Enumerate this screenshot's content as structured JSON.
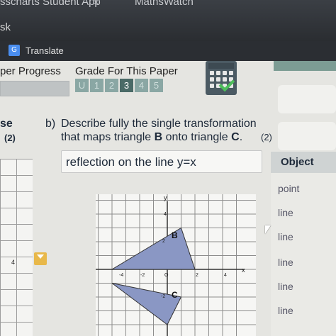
{
  "browser": {
    "tab_title": "sscharts Student App",
    "tab_close": "×",
    "tab_second": "MathsWatch",
    "address_prefix": "sk",
    "bookmark_translate": "Translate"
  },
  "header": {
    "paper_progress_label": "per Progress",
    "grade_label": "Grade For This Paper",
    "grades": [
      "U",
      "1",
      "2",
      "3",
      "4",
      "5"
    ],
    "active_grade": "3"
  },
  "left_panel": {
    "label": "se",
    "marks": "(2)",
    "axis_label": "4"
  },
  "question": {
    "part": "b)",
    "line1": "Describe fully the single transformation",
    "line2_prefix": "that maps triangle ",
    "line2_b": "B",
    "line2_mid": " onto triangle ",
    "line2_c": "C",
    "line2_end": ".",
    "marks": "(2)",
    "answer": "reflection on the line y=x"
  },
  "graph": {
    "x_label": "x",
    "y_label": "y",
    "tick_labels": [
      "-4",
      "-2",
      "O",
      "2",
      "4",
      "4",
      "2",
      "-2"
    ],
    "triangle_b_label": "B",
    "triangle_c_label": "C",
    "triangle_b": [
      [
        -4,
        0
      ],
      [
        2,
        0
      ],
      [
        1,
        3
      ]
    ],
    "triangle_c": [
      [
        -4,
        -1
      ],
      [
        0,
        -4
      ],
      [
        1,
        -2
      ]
    ]
  },
  "side_table": {
    "header": "Object",
    "rows": [
      "point",
      "line",
      "line",
      "line",
      "line",
      "line"
    ]
  }
}
